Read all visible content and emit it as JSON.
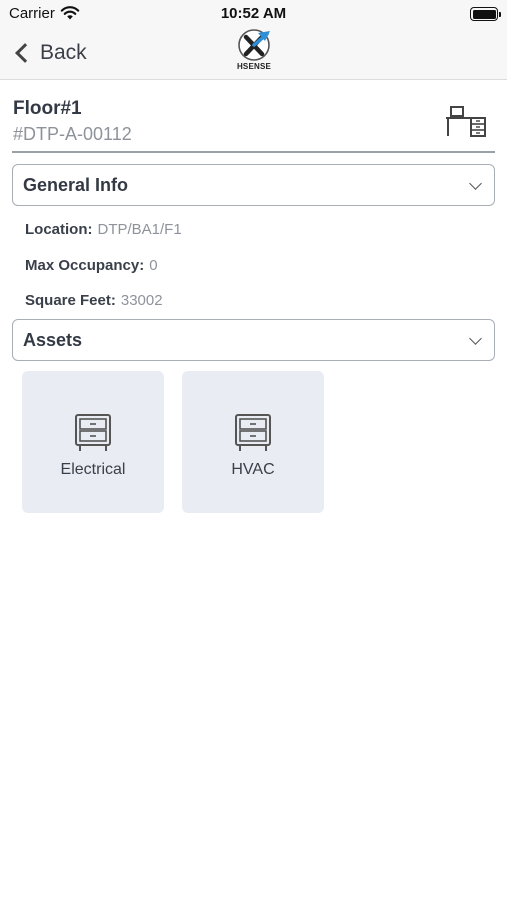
{
  "status_bar": {
    "carrier": "Carrier",
    "time": "10:52 AM"
  },
  "nav": {
    "back_label": "Back",
    "logo_text": "HSENSE",
    "accent_color": "#2e8fd6"
  },
  "asset": {
    "title": "Floor#1",
    "id": "#DTP-A-00112"
  },
  "general_info": {
    "label": "General Info",
    "rows": [
      {
        "key": "Location:",
        "value": "DTP/BA1/F1"
      },
      {
        "key": "Max Occupancy:",
        "value": "0"
      },
      {
        "key": "Square Feet:",
        "value": "33002"
      }
    ]
  },
  "assets_section": {
    "label": "Assets",
    "items": [
      {
        "label": "Electrical",
        "icon": "cabinet-icon"
      },
      {
        "label": "HVAC",
        "icon": "cabinet-icon"
      }
    ]
  }
}
